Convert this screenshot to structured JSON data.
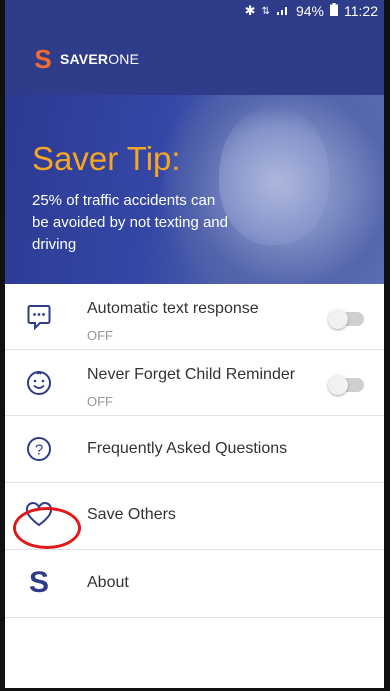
{
  "status_bar": {
    "bluetooth_icon": "bluetooth-icon",
    "data_icon": "data-icon",
    "signal_icon": "signal-icon",
    "battery": "94%",
    "time": "11:22"
  },
  "app_bar": {
    "brand_bold": "SAVER",
    "brand_light": "ONE",
    "logo_letter": "S"
  },
  "banner": {
    "title": "Saver Tip:",
    "text": "25% of traffic accidents can be avoided by not texting and driving"
  },
  "menu": {
    "items": [
      {
        "label": "Automatic text response",
        "sub": "OFF",
        "icon": "message-bubble-icon",
        "toggle": false
      },
      {
        "label": "Never Forget Child Reminder",
        "sub": "OFF",
        "icon": "child-face-icon",
        "toggle": false
      },
      {
        "label": "Frequently Asked Questions",
        "icon": "question-circle-icon"
      },
      {
        "label": "Save Others",
        "icon": "heart-icon"
      },
      {
        "label": "About",
        "icon": "saverone-s-icon",
        "letter": "S"
      }
    ]
  },
  "colors": {
    "brand_blue": "#2e3c8a",
    "accent_orange": "#f6a623",
    "logo_orange": "#f26c32",
    "highlight_red": "#e01818"
  }
}
